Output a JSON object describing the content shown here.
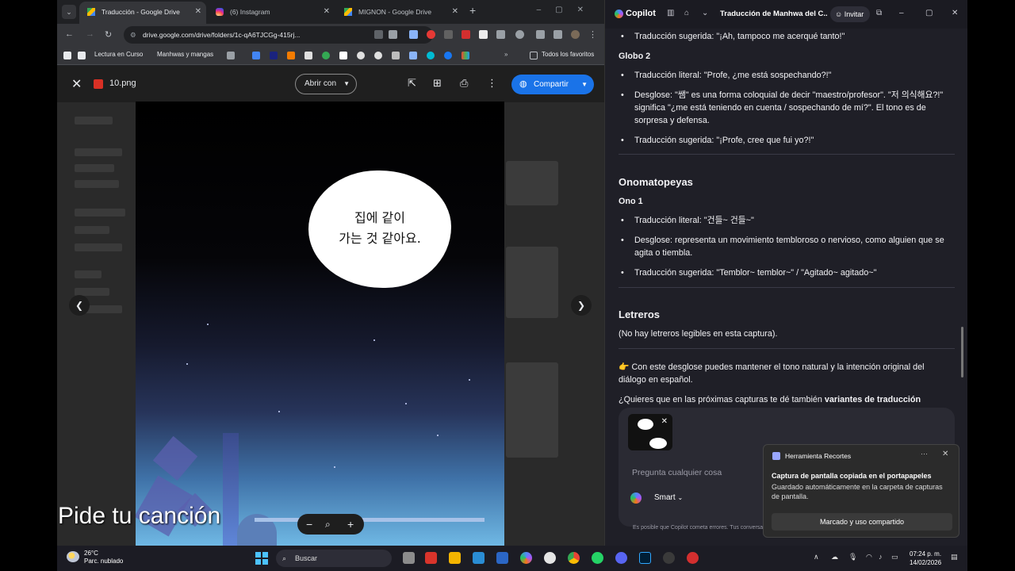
{
  "chrome": {
    "tabs": [
      {
        "title": "Traducción - Google Drive"
      },
      {
        "title": "(6) Instagram"
      },
      {
        "title": "MIGNON - Google Drive"
      }
    ],
    "url": "drive.google.com/drive/folders/1c-qA6TJCGg-415rj...",
    "bookmarks": {
      "item1": "Lectura en Curso",
      "item2": "Manhwas y mangas",
      "all": "Todos los favoritos"
    }
  },
  "viewer": {
    "file_name": "10.png",
    "open_with": "Abrir con",
    "share": "Compartir",
    "bubble_line1": "집에 같이",
    "bubble_line2": "가는 것 같아요."
  },
  "overlay": {
    "text": "Pide tu canción"
  },
  "copilot": {
    "brand": "Copilot",
    "conversation_title": "Traducción de Manhwa del C...",
    "invite": "Invitar",
    "items": {
      "sug_prev": "Traducción sugerida: \"¡Ah, tampoco me acerqué tanto!\"",
      "globo2": "Globo 2",
      "g2_literal": "Traducción literal: \"Profe, ¿me está sospechando?!\"",
      "g2_desglose": "Desglose: \"쌤\" es una forma coloquial de decir \"maestro/profesor\". \"저 의식해요?!\" significa \"¿me está teniendo en cuenta / sospechando de mí?\". El tono es de sorpresa y defensa.",
      "g2_sugerida": "Traducción sugerida: \"¡Profe, cree que fui yo?!\"",
      "onomatopeyas": "Onomatopeyas",
      "ono1": "Ono 1",
      "o1_literal": "Traducción literal: \"건들~ 건들~\"",
      "o1_desglose": "Desglose: representa un movimiento tembloroso o nervioso, como alguien que se agita o tiembla.",
      "o1_sugerida": "Traducción sugerida: \"Temblor~ temblor~\" / \"Agitado~ agitado~\"",
      "letreros": "Letreros",
      "letreros_text": "(No hay letreros legibles en esta captura).",
      "closing": "👉 Con este desglose puedes mantener el tono natural y la intención original del diálogo en español.",
      "question_start": "¿Quieres que en las próximas capturas te dé también ",
      "question_bold": "variantes de traducción"
    },
    "composer": {
      "placeholder": "Pregunta cualquier cosa",
      "mode": "Smart"
    },
    "disclaimer": "Es posible que Copilot cometa errores. Tus conversac..."
  },
  "toast": {
    "app": "Herramienta Recortes",
    "title": "Captura de pantalla copiada en el portapapeles",
    "body": "Guardado automáticamente en la carpeta de capturas de pantalla.",
    "button": "Marcado y uso compartido"
  },
  "taskbar": {
    "temp": "26°C",
    "weather": "Parc. nublado",
    "search": "Buscar",
    "time": "07:24 p. m.",
    "date": "14/02/2026"
  }
}
